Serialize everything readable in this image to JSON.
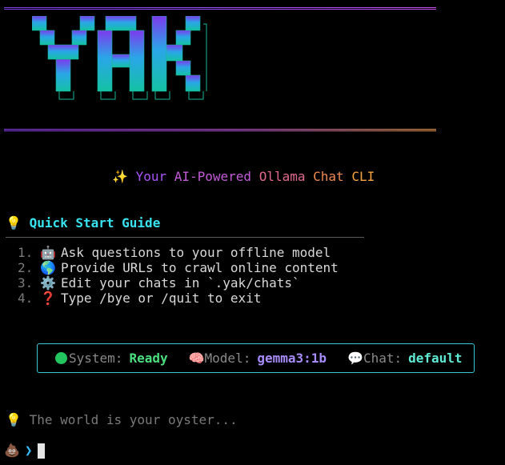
{
  "banner": {
    "logo_text": "YAK",
    "colors": {
      "rule_top": "#9b4dff",
      "rule_mid": "#f2a24c",
      "logo_top": "#7c3aed",
      "logo_mid": "#2aa6e8",
      "logo_bottom": "#14c2a3"
    }
  },
  "tagline": {
    "icon": "sparkles-icon",
    "your": "Your",
    "ai_powered": "AI-Powered",
    "ollama": "Ollama",
    "chat": "Chat",
    "cli": "CLI"
  },
  "guide": {
    "icon": "lightbulb-icon",
    "title": "Quick Start Guide",
    "items": [
      {
        "number": "1.",
        "icon": "robot-icon",
        "text": "Ask questions to your offline model"
      },
      {
        "number": "2.",
        "icon": "globe-icon",
        "text": "Provide URLs to crawl online content"
      },
      {
        "number": "3.",
        "icon": "gear-icon",
        "text": "Edit your chats in `.yak/chats`"
      },
      {
        "number": "4.",
        "icon": "question-mark-icon",
        "text": "Type /bye or /quit to exit"
      }
    ]
  },
  "status": {
    "system_label": "System:",
    "system_value": "Ready",
    "model_label": "Model:",
    "model_value": "gemma3:1b",
    "chat_label": "Chat:",
    "chat_value": "default"
  },
  "hint": {
    "icon": "lightbulb-icon",
    "text": "The world is your oyster..."
  },
  "prompt": {
    "icon": "poop-icon",
    "arrow": "❯"
  }
}
